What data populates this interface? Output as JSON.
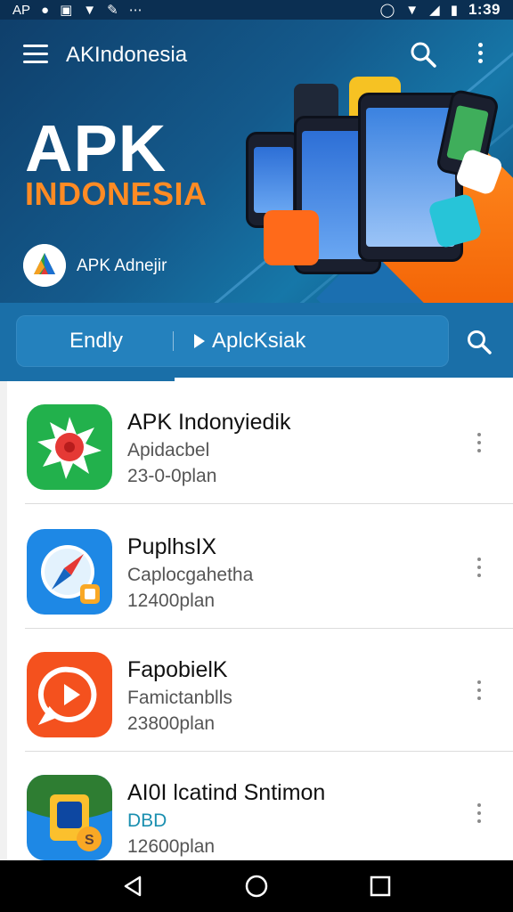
{
  "status_bar": {
    "left_text": "AP",
    "time": "1:39",
    "icons": [
      "notification-icon",
      "gallery-icon",
      "wifi-icon",
      "pencil-icon",
      "more-icon",
      "alarm-icon",
      "wifi-icon",
      "signal-icon",
      "battery-icon"
    ]
  },
  "appbar": {
    "title": "AKIndonesia"
  },
  "hero": {
    "title": "APK",
    "subtitle": "INDONESIA",
    "logo_label": "APK Adnejir"
  },
  "tabs": [
    {
      "label": "Endly"
    },
    {
      "label": "AplcKsiak"
    }
  ],
  "apps": [
    {
      "name": "APK Indonyiedik",
      "category": "Apidacbel",
      "size": "23-0-0plan",
      "icon": "sun-badge-icon"
    },
    {
      "name": "PuplhsIX",
      "category": "Caplocgahetha",
      "size": "12400plan",
      "icon": "compass-icon"
    },
    {
      "name": "FapobielK",
      "category": "Famictanblls",
      "size": "23800plan",
      "icon": "play-bubble-icon"
    },
    {
      "name": "AI0I lcatind Sntimon",
      "category": "DBD",
      "size": "12600plan",
      "icon": "bag-icon"
    }
  ],
  "colors": {
    "banner_dark": "#0f3f6b",
    "banner_accent_orange": "#ff8b24",
    "tab_bar": "#1a6fa8",
    "text_primary": "#111111",
    "text_secondary": "#555555"
  }
}
